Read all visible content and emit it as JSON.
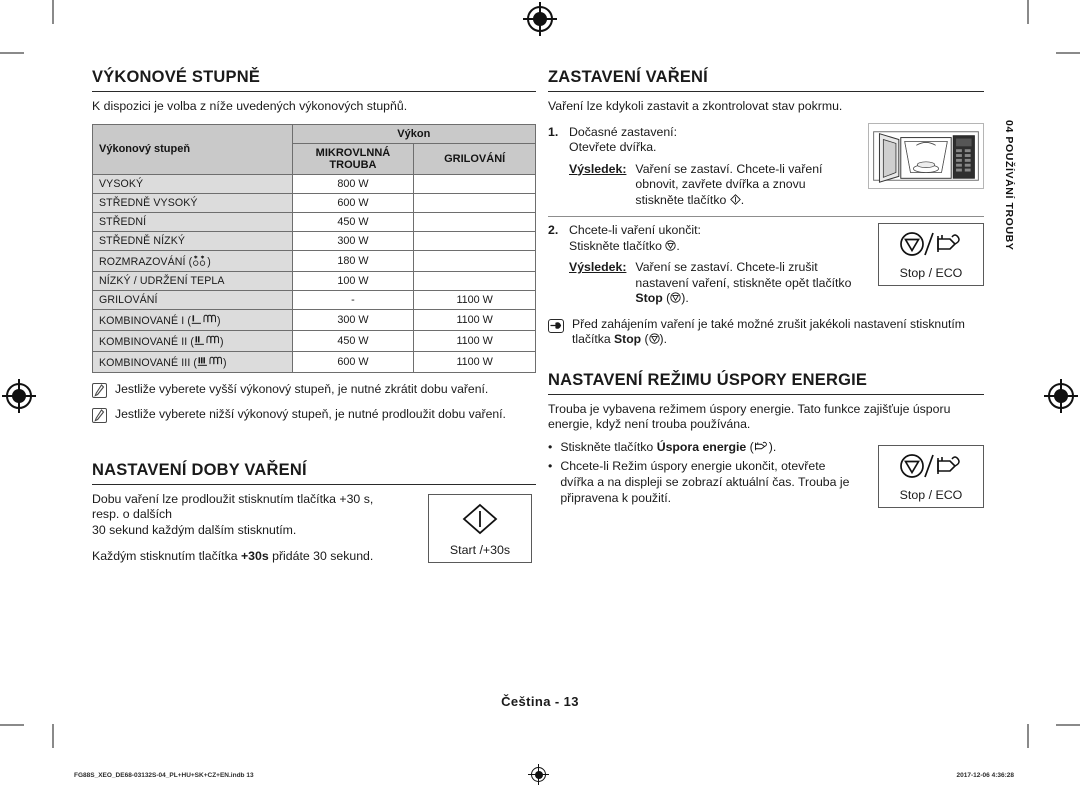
{
  "document": {
    "side_tab": "04  POUŽÍVÁNÍ TROUBY",
    "page_label": "Čeština - 13",
    "print_file": "FG88S_XEO_DE68-03132S-04_PL+HU+SK+CZ+EN.indb   13",
    "print_date": "2017-12-06   4:36:28"
  },
  "left": {
    "power_section": {
      "title": "VÝKONOVÉ STUPNĚ",
      "intro": "K dispozici je volba z níže uvedených výkonových stupňů.",
      "table": {
        "header_level": "Výkonový stupeň",
        "header_power": "Výkon",
        "header_microwave": "MIKROVLNNÁ TROUBA",
        "header_grill": "GRILOVÁNÍ",
        "rows": [
          {
            "level": "VYSOKÝ",
            "microwave": "800 W",
            "grill": ""
          },
          {
            "level": "STŘEDNĚ VYSOKÝ",
            "microwave": "600 W",
            "grill": ""
          },
          {
            "level": "STŘEDNÍ",
            "microwave": "450 W",
            "grill": ""
          },
          {
            "level": "STŘEDNĚ NÍZKÝ",
            "microwave": "300 W",
            "grill": ""
          },
          {
            "level": "ROZMRAZOVÁNÍ (",
            "level_suffix": ")",
            "symbol": "defrost",
            "microwave": "180 W",
            "grill": ""
          },
          {
            "level": "NÍZKÝ / UDRŽENÍ TEPLA",
            "microwave": "100 W",
            "grill": ""
          },
          {
            "level": "GRILOVÁNÍ",
            "microwave": "-",
            "grill": "1100 W"
          },
          {
            "level": "KOMBINOVANÉ I (",
            "level_suffix": ")",
            "symbol": "combi1",
            "microwave": "300 W",
            "grill": "1100 W"
          },
          {
            "level": "KOMBINOVANÉ II (",
            "level_suffix": ")",
            "symbol": "combi2",
            "microwave": "450 W",
            "grill": "1100 W"
          },
          {
            "level": "KOMBINOVANÉ III (",
            "level_suffix": ")",
            "symbol": "combi3",
            "microwave": "600 W",
            "grill": "1100 W"
          }
        ]
      },
      "notes": [
        "Jestliže vyberete vyšší výkonový stupeň, je nutné zkrátit dobu vaření.",
        "Jestliže vyberete nižší výkonový stupeň, je nutné prodloužit dobu vaření."
      ]
    },
    "time_section": {
      "title": "NASTAVENÍ DOBY VAŘENÍ",
      "paragraph1_line1": "Dobu vaření lze prodloužit stisknutím tlačítka +30 s,",
      "paragraph1_line2": "resp. o dalších",
      "paragraph1_line3": "30 sekund každým dalším stisknutím.",
      "paragraph2_pre": "Každým stisknutím tlačítka ",
      "paragraph2_bold": "+30s",
      "paragraph2_post": " přidáte 30 sekund.",
      "key_label": "Start /+30s"
    }
  },
  "right": {
    "stop_section": {
      "title": "ZASTAVENÍ VAŘENÍ",
      "intro": "Vaření lze kdykoli zastavit a zkontrolovat stav pokrmu.",
      "step1_num": "1.",
      "step1_line1": "Dočasné zastavení:",
      "step1_line2": "Otevřete dvířka.",
      "result_label": "Výsledek:",
      "step1_result_line1": "Vaření se zastaví. Chcete-li vaření",
      "step1_result_line2": "obnovit, zavřete dvířka a znovu",
      "step1_result_line3_pre": "stiskněte tlačítko ",
      "step1_result_line3_post": ".",
      "step2_num": "2.",
      "step2_line1": "Chcete-li vaření ukončit:",
      "step2_line2_pre": "Stiskněte tlačítko ",
      "step2_line2_post": ".",
      "step2_result_line1": "Vaření se zastaví. Chcete-li zrušit",
      "step2_result_line2": "nastavení vaření, stiskněte opět tlačítko",
      "step2_result_line3_bold": "Stop",
      "step2_result_line3_post": ").",
      "tip_line1": "Před zahájením vaření je také možné zrušit jakékoli nastavení stisknutím",
      "tip_line2_pre": "tlačítka ",
      "tip_line2_bold": "Stop",
      "tip_line2_post": ").",
      "key_label": "Stop / ECO"
    },
    "eco_section": {
      "title": "NASTAVENÍ REŽIMU ÚSPORY ENERGIE",
      "intro_line1": "Trouba je vybavena režimem úspory energie. Tato funkce zajišťuje úsporu",
      "intro_line2": "energie, když není trouba používána.",
      "bullet_char": "•",
      "bullet1_pre": "Stiskněte tlačítko ",
      "bullet1_bold": "Úspora energie",
      "bullet1_post": ").",
      "bullet2_line1": "Chcete-li Režim úspory energie ukončit, otevřete",
      "bullet2_line2": "dvířka a na displeji se zobrazí aktuální čas. Trouba je",
      "bullet2_line3": "připravena k použití.",
      "key_label": "Stop / ECO"
    }
  },
  "icons": {
    "note_icon": "note-pencil-icon",
    "tip_icon": "pointing-hand-icon",
    "start_icon": "start-diamond-icon",
    "stop_icon": "stop-triangle-icon",
    "eco_icon": "eco-plug-icon",
    "oven_illustration": "microwave-oven-open-door-illustration",
    "registration_mark": "print-registration-mark"
  },
  "colors": {
    "table_header_bg": "#c9c9c9",
    "table_level_bg": "#dcdcdc",
    "rule": "#2a2a2a",
    "text": "#1a1a1a"
  }
}
